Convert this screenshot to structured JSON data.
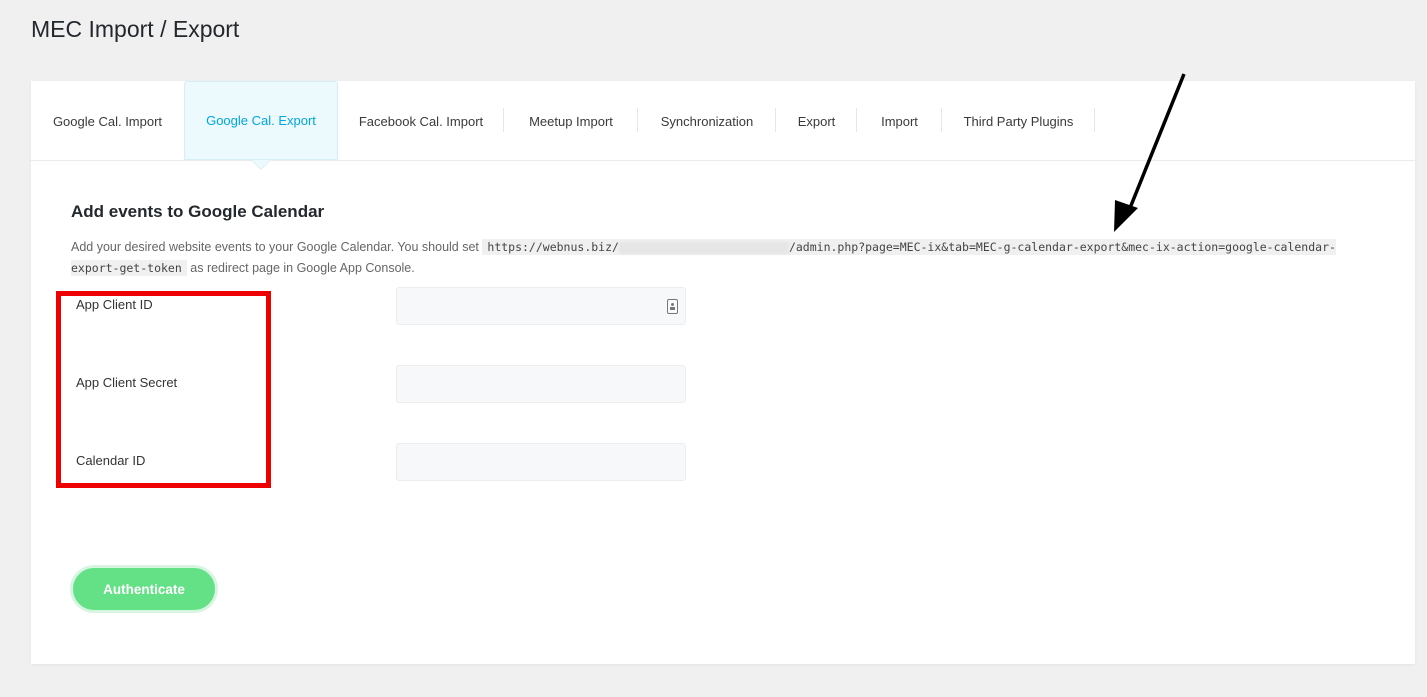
{
  "page_title": "MEC Import / Export",
  "tabs": [
    {
      "label": "Google Cal. Import"
    },
    {
      "label": "Google Cal. Export",
      "active": true
    },
    {
      "label": "Facebook Cal. Import"
    },
    {
      "label": "Meetup Import"
    },
    {
      "label": "Synchronization"
    },
    {
      "label": "Export"
    },
    {
      "label": "Import"
    },
    {
      "label": "Third Party Plugins"
    }
  ],
  "section": {
    "title": "Add events to Google Calendar",
    "desc_before": "Add your desired website events to your Google Calendar. You should set",
    "url_start": "https://webnus.biz/",
    "url_end": "/admin.php?page=MEC-ix&tab=MEC-g-calendar-export&mec-ix-action=google-calendar-export-get-token",
    "desc_after": "as redirect page in Google App Console."
  },
  "fields": [
    {
      "label": "App Client ID",
      "value": ""
    },
    {
      "label": "App Client Secret",
      "value": ""
    },
    {
      "label": "Calendar ID",
      "value": ""
    }
  ],
  "authenticate_label": "Authenticate",
  "colors": {
    "active_tab": "#00a6e0",
    "button": "#64e086",
    "highlight": "#ee0000"
  },
  "icons": [
    "key-icon",
    "arrow-annotation"
  ]
}
